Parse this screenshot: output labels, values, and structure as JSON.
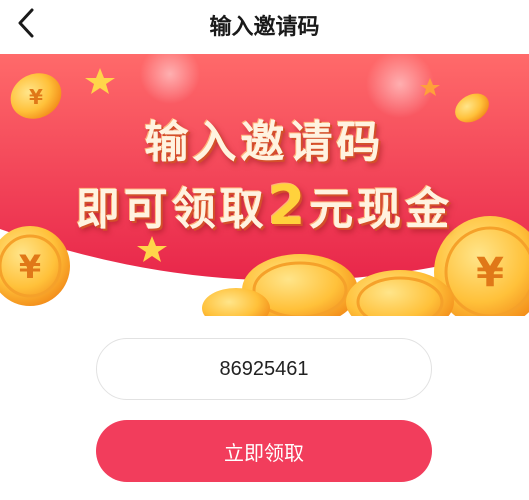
{
  "header": {
    "title": "输入邀请码",
    "back_icon": "chevron-left-icon"
  },
  "banner": {
    "line1": "输入邀请码",
    "line2_prefix": "即可领取",
    "line2_amount": "2",
    "line2_suffix": "元现金",
    "colors": {
      "bg_top": "#ff5b63",
      "bg_bottom": "#e8294a",
      "gold": "#ffc13a"
    }
  },
  "form": {
    "code_value": "86925461",
    "submit_label": "立即领取"
  }
}
